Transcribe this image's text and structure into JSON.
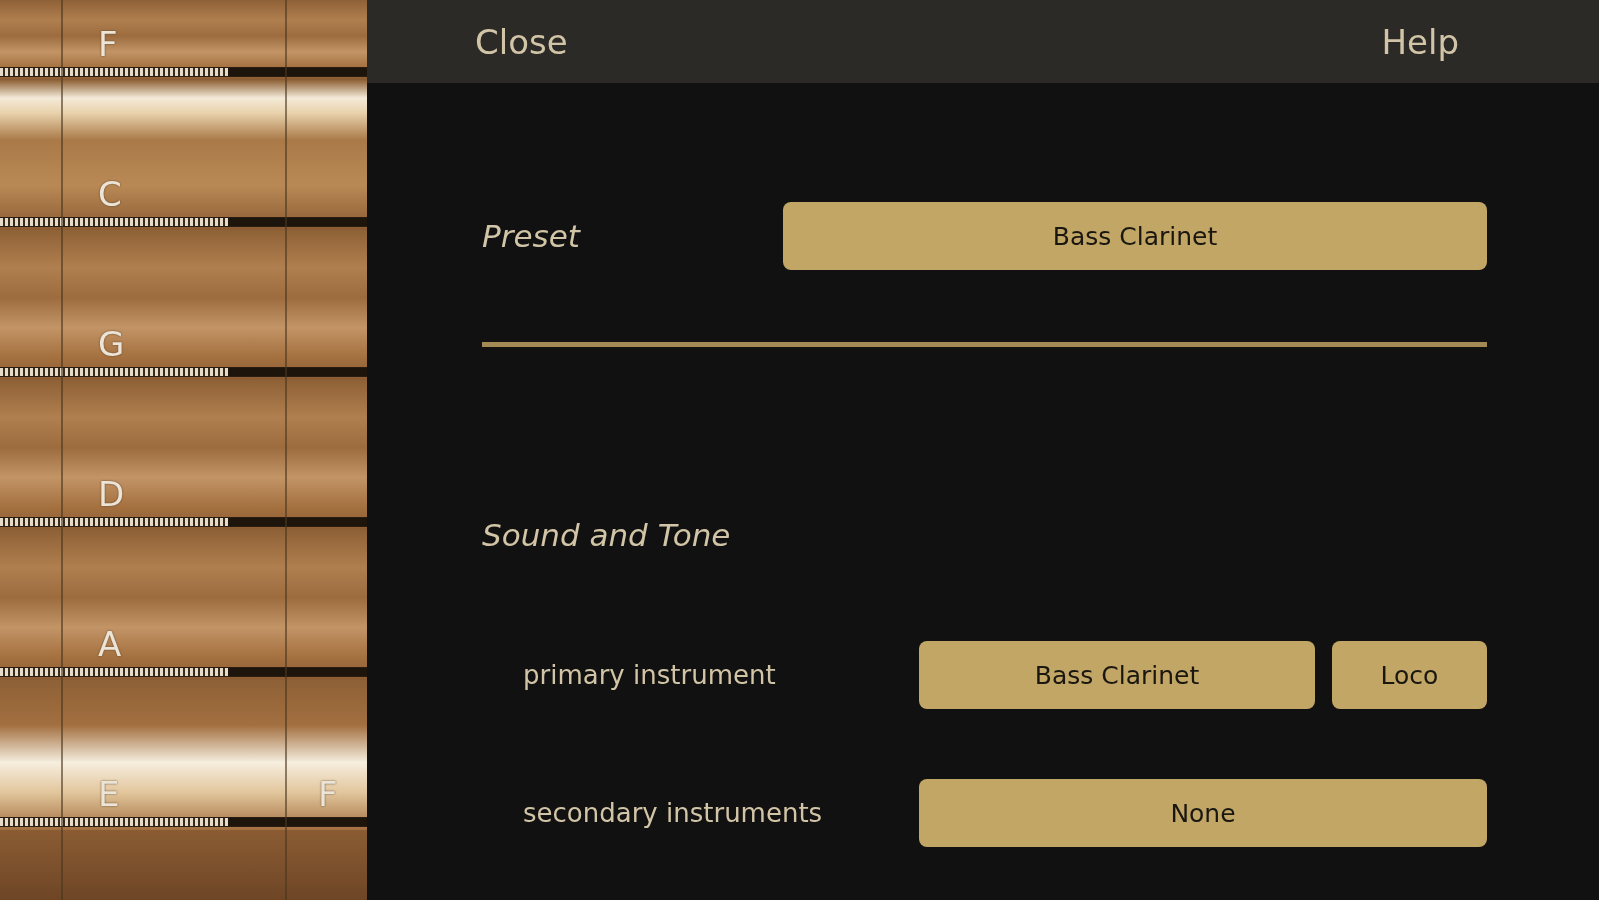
{
  "strings": [
    {
      "notes": [
        "F"
      ]
    },
    {
      "notes": [
        "C"
      ]
    },
    {
      "notes": [
        "G"
      ]
    },
    {
      "notes": [
        "D"
      ]
    },
    {
      "notes": [
        "A"
      ]
    },
    {
      "notes": [
        "E",
        "F"
      ]
    }
  ],
  "header": {
    "close": "Close",
    "help": "Help"
  },
  "preset": {
    "label": "Preset",
    "value": "Bass Clarinet"
  },
  "section": {
    "title": "Sound and Tone"
  },
  "settings": [
    {
      "label": "primary instrument",
      "buttons": [
        "Bass Clarinet",
        "Loco"
      ]
    },
    {
      "label": "secondary instruments",
      "buttons": [
        "None"
      ]
    }
  ]
}
